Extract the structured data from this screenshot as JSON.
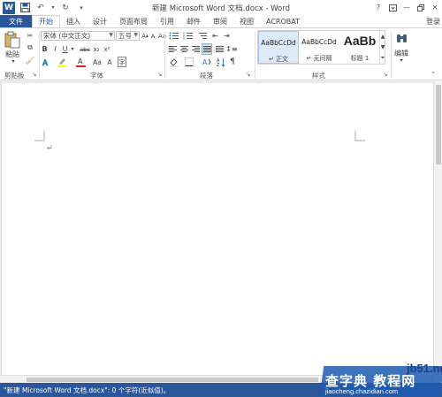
{
  "window": {
    "title": "新建 Microsoft Word 文档.docx - Word",
    "login": "登录",
    "icons": [
      "save-icon",
      "undo-icon",
      "redo-icon",
      "customize-icon",
      "help-icon",
      "ribbon-display-icon",
      "minimize-icon",
      "restore-icon",
      "close-icon"
    ]
  },
  "tabs": [
    {
      "label": "文件"
    },
    {
      "label": "开始"
    },
    {
      "label": "插入"
    },
    {
      "label": "设计"
    },
    {
      "label": "页面布局"
    },
    {
      "label": "引用"
    },
    {
      "label": "邮件"
    },
    {
      "label": "审阅"
    },
    {
      "label": "视图"
    },
    {
      "label": "ACROBAT"
    }
  ],
  "ribbon": {
    "clipboard": {
      "paste_label": "粘贴",
      "group_label": "剪贴板"
    },
    "font": {
      "font_name": "宋体 (中文正文)",
      "font_size": "五号",
      "group_label": "字体"
    },
    "paragraph": {
      "group_label": "段落"
    },
    "styles": {
      "group_label": "样式",
      "items": [
        {
          "sample": "AaBbCcDd",
          "name": "↵ 正文"
        },
        {
          "sample": "AaBbCcDd",
          "name": "↵ 无间隔"
        },
        {
          "sample": "AaBb",
          "name": "标题 1"
        }
      ]
    },
    "editing": {
      "label": "编辑"
    }
  },
  "document": {
    "paragraph_mark": "↵"
  },
  "statusbar": {
    "text": "\"新建 Microsoft Word 文档.docx\": 0 个字符(近似值)。"
  },
  "watermark": {
    "line1": "jb51.net",
    "line2": "查字典 教程网",
    "line3": "jiaocheng.chazidian.com"
  },
  "colors": {
    "accent": "#2b579a",
    "ribbon_border": "#d4d4d4",
    "doc_bg": "#e8e8e8"
  }
}
